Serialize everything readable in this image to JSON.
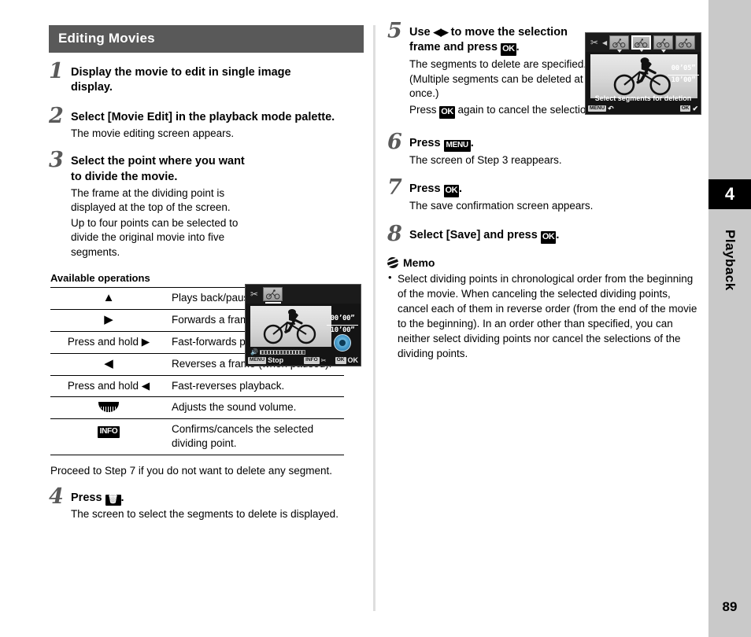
{
  "page": {
    "number": "89",
    "chapter_number": "4",
    "chapter_label": "Playback"
  },
  "section": {
    "title": "Editing Movies"
  },
  "left_column": {
    "steps": [
      {
        "num": "1",
        "title": "Display the movie to edit in single image display.",
        "body": []
      },
      {
        "num": "2",
        "title": "Select [Movie Edit] in the playback mode palette.",
        "body": [
          "The movie editing screen appears."
        ]
      },
      {
        "num": "3",
        "title": "Select the point where you want to divide the movie.",
        "body": [
          "The frame at the dividing point is displayed at the top of the screen.",
          "Up to four points can be selected to divide the original movie into five segments."
        ]
      },
      {
        "num": "4",
        "title_pre": "Press ",
        "title_key": "trash-icon",
        "title_post": ".",
        "body": [
          "The screen to select the segments to delete is displayed."
        ]
      }
    ],
    "operations_table": {
      "title": "Available operations",
      "rows": [
        {
          "key_type": "triangle-up",
          "key_text": "▲",
          "desc": "Plays back/pauses a movie."
        },
        {
          "key_type": "triangle-right",
          "key_text": "▶",
          "desc": "Forwards a frame (when paused)."
        },
        {
          "key_type": "hold-right",
          "key_text": "Press and hold ▶",
          "desc": "Fast-forwards playback."
        },
        {
          "key_type": "triangle-left",
          "key_text": "◀",
          "desc": "Reverses a frame (when paused)."
        },
        {
          "key_type": "hold-left",
          "key_text": "Press and hold ◀",
          "desc": "Fast-reverses playback."
        },
        {
          "key_type": "volume-dial",
          "key_text": "",
          "desc": "Adjusts the sound volume."
        },
        {
          "key_type": "info-button",
          "key_text": "INFO",
          "desc": "Confirms/cancels the selected dividing point."
        }
      ]
    },
    "proceed_note": "Proceed to Step 7 if you do not want to delete any segment."
  },
  "right_column": {
    "steps": [
      {
        "num": "5",
        "title_parts": [
          "Use ",
          "◀▶",
          " to move the selection frame and press ",
          "OK",
          "."
        ],
        "body": [
          "The segments to delete are specified. (Multiple segments can be deleted at once.)"
        ],
        "body_with_key": {
          "pre": "Press ",
          "key": "OK",
          "post": " again to cancel the selection."
        }
      },
      {
        "num": "6",
        "title_pre": "Press ",
        "title_key": "MENU",
        "title_post": ".",
        "body": [
          "The screen of Step 3 reappears."
        ]
      },
      {
        "num": "7",
        "title_pre": "Press ",
        "title_key": "OK",
        "title_post": ".",
        "body": [
          "The save confirmation screen appears."
        ]
      },
      {
        "num": "8",
        "title_pre": "Select [Save] and press ",
        "title_key": "OK",
        "title_post": ".",
        "body": []
      }
    ],
    "memo": {
      "title": "Memo",
      "items": [
        "Select dividing points in chronological order from the beginning of the movie. When canceling the selected dividing points, cancel each of them in reverse order (from the end of the movie to the beginning). In an order other than specified, you can neither select dividing points nor cancel the selections of the dividing points."
      ]
    }
  },
  "lcd_screen_step3": {
    "mode_icon": "scissors-icon",
    "timecode_current": "00’00”",
    "timecode_total": "10’00”",
    "bottom_menu_badge": "MENU",
    "bottom_menu_label": "Stop",
    "bottom_info_badge": "INFO",
    "bottom_info_label": "✂",
    "bottom_ok_badge": "OK",
    "bottom_ok_label": "OK",
    "thumbnail_count": 1
  },
  "lcd_screen_step5": {
    "mode_icon": "scissors-icon",
    "timecode_current": "00’05”",
    "timecode_total": "10’00”",
    "caption": "Select segments for deletion",
    "bottom_menu_badge": "MENU",
    "bottom_menu_label": "↶",
    "bottom_ok_badge": "OK",
    "bottom_ok_label": "✔",
    "thumbnail_count": 4,
    "selected_thumbnail_index": 2
  },
  "colors": {
    "header_bar": "#595959",
    "side_strip": "#c9c9c9",
    "tab_number": "#000000",
    "step_number": "#5a5a5a",
    "divider": "#dedede"
  }
}
